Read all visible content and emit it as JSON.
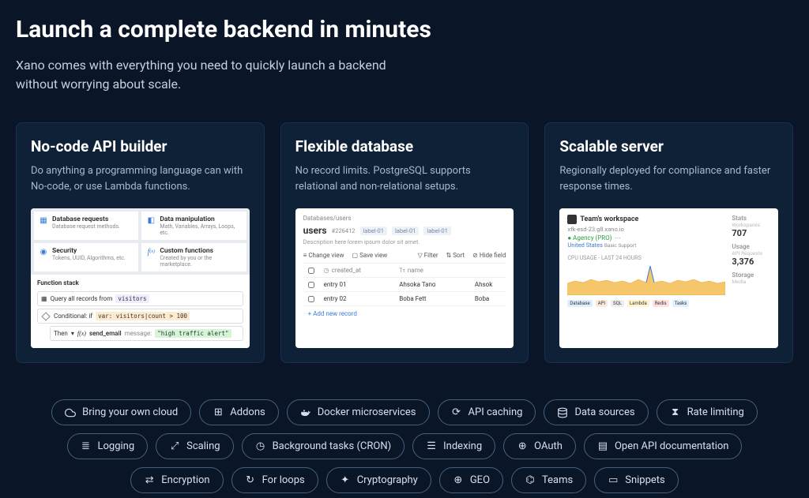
{
  "hero": {
    "title": "Launch a complete backend in minutes",
    "subtitle": "Xano comes with everything you need to quickly launch a backend without worrying about scale."
  },
  "cards": [
    {
      "title": "No-code API builder",
      "desc": "Do anything a programming language can with No-code, or use Lambda functions.",
      "tiles": [
        {
          "title": "Database requests",
          "sub": "Database request methods."
        },
        {
          "title": "Data manipulation",
          "sub": "Math, Variables, Arrays, Loops, etc."
        },
        {
          "title": "Security",
          "sub": "Tokens, UUID, Algorithms, etc."
        },
        {
          "title": "Custom functions",
          "sub": "Created by you or the marketplace."
        }
      ],
      "stack": {
        "header": "Function stack",
        "query_prefix": "Query all records from",
        "query_table": "visitors",
        "cond_prefix": "Conditional: if",
        "cond_var": "var: visitors|count > 100",
        "then": "Then",
        "fn": "send_email",
        "msg_key": "message:",
        "msg_val": "\"high traffic alert\""
      }
    },
    {
      "title": "Flexible database",
      "desc": "No record limits. PostgreSQL supports relational and non-relational setups.",
      "db": {
        "path": "Databases/users",
        "name": "users",
        "id": "#226412",
        "labels": [
          "label-01",
          "label-01",
          "label-01"
        ],
        "desc": "Description here lorem ipsum dolor sit amet.",
        "toolbar": [
          "Change view",
          "Save view",
          "Filter",
          "Sort",
          "Hide field"
        ],
        "cols": [
          "created_at",
          "name"
        ],
        "rows": [
          [
            "entry 01",
            "Ahsoka Tano",
            "Ahsok"
          ],
          [
            "entry 02",
            "Boba Fett",
            "Boba"
          ]
        ],
        "add": "+ Add new record"
      }
    },
    {
      "title": "Scalable server",
      "desc": "Regionally deployed for compliance and faster response times.",
      "sv": {
        "workspace": "Team's workspace",
        "url": "xfk-esd-23.g8.xano.io",
        "agency": "Agency (PRO)",
        "region": "United States",
        "region_badge": "Basic Support",
        "stats": [
          {
            "label": "Stats",
            "sub": "Workspaces",
            "val": "707"
          },
          {
            "label": "Usage",
            "sub": "API Requests",
            "val": "3,376"
          },
          {
            "label": "Storage",
            "sub": "Media",
            "val": ""
          }
        ],
        "chart_title": "CPU USAGE - LAST 24 HOURS",
        "legend": [
          "Database",
          "API",
          "SQL",
          "Lambda",
          "Redis",
          "Tasks"
        ]
      }
    }
  ],
  "pills": [
    {
      "icon": "cloud",
      "label": "Bring your own cloud"
    },
    {
      "icon": "addons",
      "label": "Addons"
    },
    {
      "icon": "docker",
      "label": "Docker microservices"
    },
    {
      "icon": "cache",
      "label": "API caching"
    },
    {
      "icon": "datasource",
      "label": "Data sources"
    },
    {
      "icon": "ratelimit",
      "label": "Rate limiting"
    },
    {
      "icon": "logging",
      "label": "Logging"
    },
    {
      "icon": "scaling",
      "label": "Scaling"
    },
    {
      "icon": "cron",
      "label": "Background tasks (CRON)"
    },
    {
      "icon": "indexing",
      "label": "Indexing"
    },
    {
      "icon": "oauth",
      "label": "OAuth"
    },
    {
      "icon": "openapi",
      "label": "Open API documentation"
    },
    {
      "icon": "encryption",
      "label": "Encryption"
    },
    {
      "icon": "forloops",
      "label": "For loops"
    },
    {
      "icon": "crypto",
      "label": "Cryptography"
    },
    {
      "icon": "geo",
      "label": "GEO"
    },
    {
      "icon": "teams",
      "label": "Teams"
    },
    {
      "icon": "snippets",
      "label": "Snippets"
    }
  ]
}
